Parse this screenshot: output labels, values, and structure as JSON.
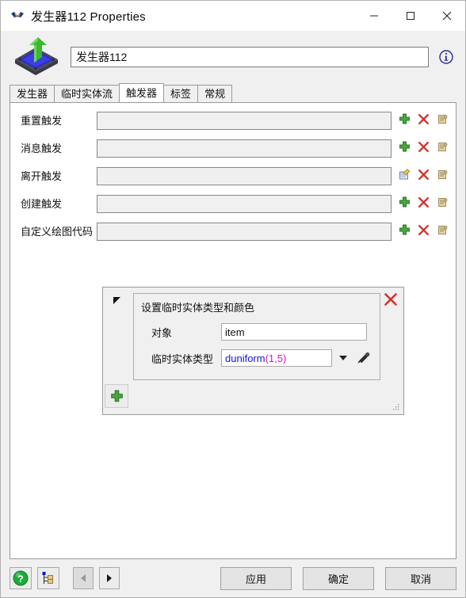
{
  "window": {
    "title": "发生器112  Properties",
    "icon": "flexsim-logo-icon",
    "minimize_label": "—",
    "maximize_label": "□",
    "close_label": "✕"
  },
  "header": {
    "object_icon": "source-object-icon",
    "name_value": "发生器112",
    "info_icon": "info-icon"
  },
  "tabs": [
    {
      "label": "发生器",
      "active": false
    },
    {
      "label": "临时实体流",
      "active": false
    },
    {
      "label": "触发器",
      "active": true
    },
    {
      "label": "标签",
      "active": false
    },
    {
      "label": "常规",
      "active": false
    }
  ],
  "trigger_rows": [
    {
      "label": "重置触发",
      "value": "",
      "icons": [
        "add-icon",
        "delete-icon",
        "script-icon"
      ]
    },
    {
      "label": "消息触发",
      "value": "",
      "icons": [
        "add-icon",
        "delete-icon",
        "script-icon"
      ]
    },
    {
      "label": "离开触发",
      "value": "",
      "icons": [
        "edit-properties-icon",
        "delete-icon",
        "script-icon"
      ]
    },
    {
      "label": "创建触发",
      "value": "",
      "icons": [
        "add-icon",
        "delete-icon",
        "script-icon"
      ]
    },
    {
      "label": "自定义绘图代码",
      "value": "",
      "icons": [
        "add-icon",
        "delete-icon",
        "script-icon"
      ]
    }
  ],
  "popup": {
    "title": "设置临时实体类型和颜色",
    "collapse_icon": "collapse-triangle-icon",
    "close_icon": "close-x-icon",
    "object_label": "对象",
    "object_value": "item",
    "itemtype_label": "临时实体类型",
    "itemtype_code": {
      "fn": "duniform",
      "open": "(",
      "arg1": "1",
      "sep": ", ",
      "arg2": "5",
      "close": ")"
    },
    "dropdown_icon": "chevron-down-icon",
    "pipette_icon": "eyedropper-icon",
    "add_icon": "add-icon",
    "resize_grip": "resize-grip-icon"
  },
  "footer": {
    "help_icon": "help-question-icon",
    "tree_icon": "tree-view-icon",
    "back_icon": "arrow-left-icon",
    "forward_icon": "arrow-right-icon",
    "apply_label": "应用",
    "ok_label": "确定",
    "cancel_label": "取消"
  },
  "colors": {
    "code_function": "#1414d2",
    "code_punct": "#e010c0",
    "accent_green": "#3f9a3f",
    "accent_red": "#cc2222",
    "window_bg": "#f0f0f0"
  }
}
